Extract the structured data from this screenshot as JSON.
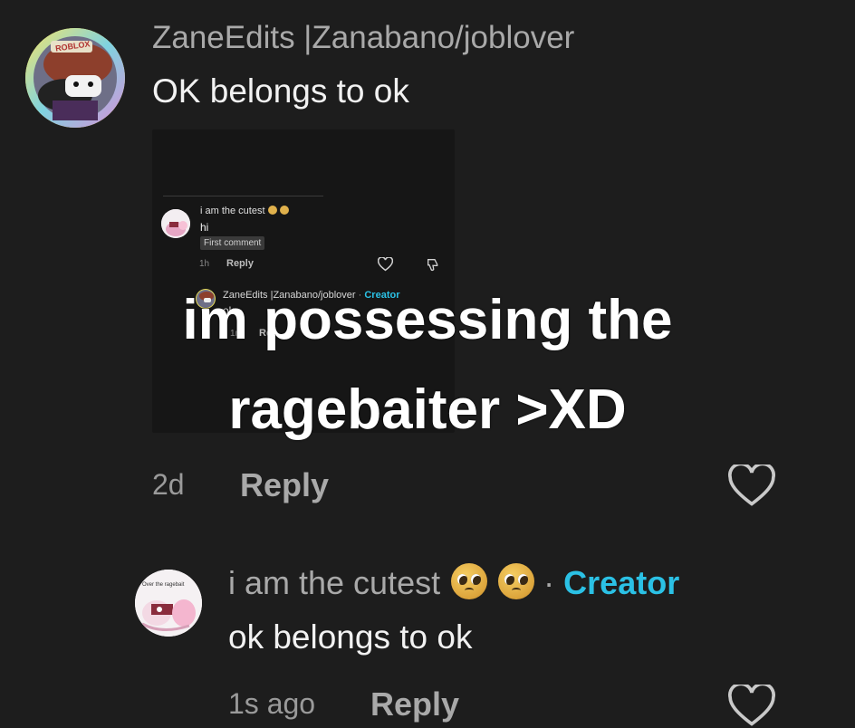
{
  "comment1": {
    "username": "ZaneEdits |Zanabano/joblover",
    "text": "OK belongs to ok",
    "avatar_badge": "ROBLOX",
    "time": "2d",
    "reply_label": "Reply"
  },
  "embedded": {
    "comment": {
      "username": "i am the cutest",
      "text": "hi",
      "badge": "First comment",
      "time": "1h",
      "reply_label": "Reply"
    },
    "reply": {
      "username": "ZaneEdits |Zanabano/joblover",
      "separator": "·",
      "creator_label": "Creator",
      "text_partial": "ok",
      "time_partial": "1m",
      "reply_partial": "Rep"
    }
  },
  "overlay": {
    "line1": "im possessing the",
    "line2": "ragebaiter >XD"
  },
  "comment2": {
    "username": "i am the cutest",
    "separator": "·",
    "creator_label": "Creator",
    "text": "ok belongs to ok",
    "avatar_caption": "Over the ragebait",
    "time": "1s ago",
    "reply_label": "Reply"
  },
  "icons": {
    "heart": "heart-icon",
    "dislike": "thumbs-down-icon",
    "emoji": "pleading-face-icon"
  },
  "colors": {
    "background": "#1d1d1d",
    "creator": "#2bc1e5",
    "muted": "#a9a9a9"
  }
}
